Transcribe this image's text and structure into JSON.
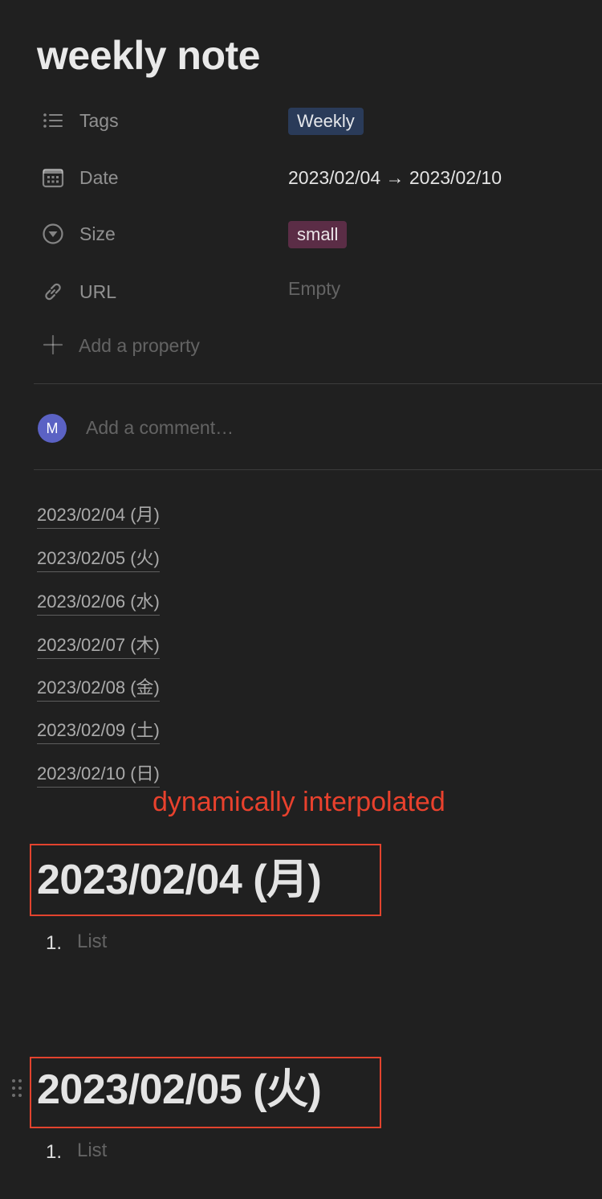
{
  "page": {
    "title": "weekly note"
  },
  "properties": [
    {
      "name": "Tags",
      "icon": "list-icon",
      "value": "Weekly",
      "type": "tag",
      "color": "#2a3b59"
    },
    {
      "name": "Date",
      "icon": "calendar-icon",
      "value": "2023/02/04 → 2023/02/10",
      "type": "text"
    },
    {
      "name": "Size",
      "icon": "select-circle-icon",
      "value": "small",
      "type": "tag",
      "color": "#5b2d46"
    },
    {
      "name": "URL",
      "icon": "link-icon",
      "value": "Empty",
      "type": "empty"
    }
  ],
  "add_property_label": "Add a property",
  "comment": {
    "avatar_initial": "M",
    "avatar_color": "#5b62c4",
    "placeholder": "Add a comment…"
  },
  "date_links": [
    "2023/02/04 (月)",
    "2023/02/05 (火)",
    "2023/02/06 (水)",
    "2023/02/07 (木)",
    "2023/02/08 (金)",
    "2023/02/09 (土)",
    "2023/02/10 (日)"
  ],
  "annotation": "dynamically interpolated",
  "annotation_color": "#e8412d",
  "sections": [
    {
      "heading": "2023/02/04 (月)",
      "list_number": "1.",
      "list_placeholder": "List"
    },
    {
      "heading": "2023/02/05 (火)",
      "list_number": "1.",
      "list_placeholder": "List"
    }
  ]
}
